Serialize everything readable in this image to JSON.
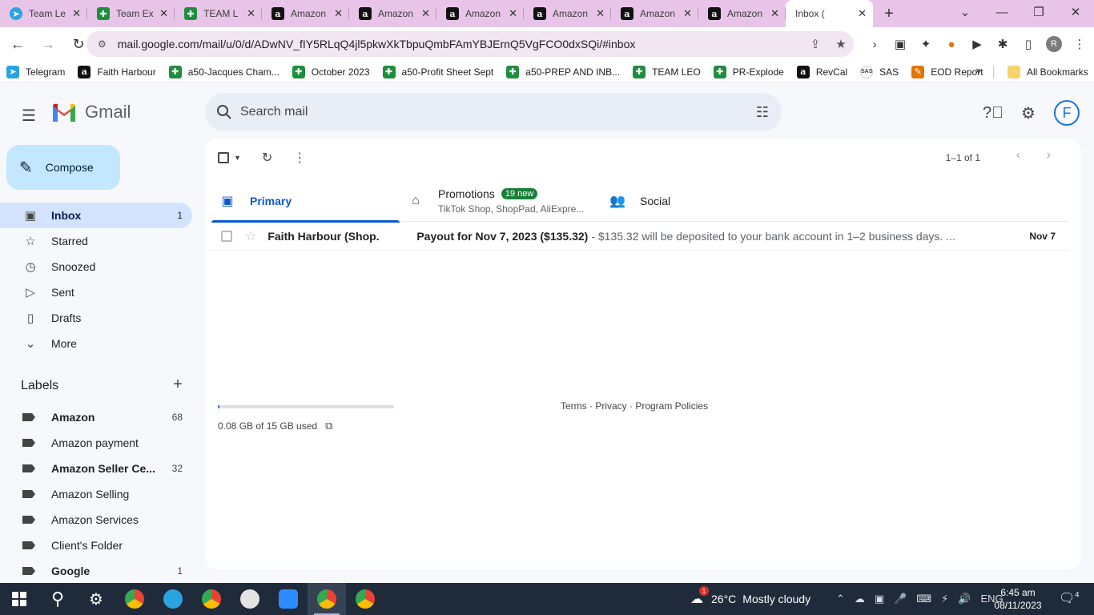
{
  "browser": {
    "tabs": [
      {
        "title": "Team Le",
        "icon": "telegram"
      },
      {
        "title": "Team Ex",
        "icon": "sheets"
      },
      {
        "title": "TEAM L",
        "icon": "sheets"
      },
      {
        "title": "Amazon",
        "icon": "amazon"
      },
      {
        "title": "Amazon",
        "icon": "amazon"
      },
      {
        "title": "Amazon",
        "icon": "amazon"
      },
      {
        "title": "Amazon",
        "icon": "amazon"
      },
      {
        "title": "Amazon",
        "icon": "amazon"
      },
      {
        "title": "Amazon",
        "icon": "amazon"
      },
      {
        "title": "Inbox (",
        "icon": "gmail"
      }
    ],
    "url": "mail.google.com/mail/u/0/d/ADwNV_fIY5RLqQ4jl5pkwXkTbpuQmbFAmYBJErnQ5VgFCO0dxSQi/#inbox",
    "profile_initial": "R",
    "bookmarks": [
      {
        "label": "Telegram",
        "icon": "telegram"
      },
      {
        "label": "Faith Harbour",
        "icon": "amazon"
      },
      {
        "label": "a50-Jacques Cham...",
        "icon": "sheets"
      },
      {
        "label": "October 2023",
        "icon": "sheets"
      },
      {
        "label": "a50-Profit Sheet Sept",
        "icon": "sheets"
      },
      {
        "label": "a50-PREP AND INB...",
        "icon": "sheets"
      },
      {
        "label": "TEAM LEO",
        "icon": "sheets"
      },
      {
        "label": "PR-Explode",
        "icon": "sheets"
      },
      {
        "label": "RevCal",
        "icon": "amazon"
      },
      {
        "label": "SAS",
        "icon": "sas"
      },
      {
        "label": "EOD Report",
        "icon": "eod"
      }
    ],
    "all_bookmarks": "All Bookmarks"
  },
  "gmail": {
    "logo_text": "Gmail",
    "search_placeholder": "Search mail",
    "account_initial": "F",
    "compose": "Compose",
    "nav": [
      {
        "label": "Inbox",
        "count": "1",
        "icon": "inbox-icon"
      },
      {
        "label": "Starred",
        "count": "",
        "icon": "star-icon"
      },
      {
        "label": "Snoozed",
        "count": "",
        "icon": "clock-icon"
      },
      {
        "label": "Sent",
        "count": "",
        "icon": "send-icon"
      },
      {
        "label": "Drafts",
        "count": "",
        "icon": "draft-icon"
      },
      {
        "label": "More",
        "count": "",
        "icon": "chevron-down-icon"
      }
    ],
    "labels_heading": "Labels",
    "labels": [
      {
        "label": "Amazon",
        "count": "68",
        "bold": true
      },
      {
        "label": "Amazon payment",
        "count": "",
        "bold": false
      },
      {
        "label": "Amazon Seller Ce...",
        "count": "32",
        "bold": true
      },
      {
        "label": "Amazon Selling",
        "count": "",
        "bold": false
      },
      {
        "label": "Amazon Services",
        "count": "",
        "bold": false
      },
      {
        "label": "Client's Folder",
        "count": "",
        "bold": false
      },
      {
        "label": "Google",
        "count": "1",
        "bold": true
      }
    ],
    "pager": "1–1 of 1",
    "tabs": {
      "primary": "Primary",
      "promotions": "Promotions",
      "promotions_badge": "19 new",
      "promotions_sub": "TikTok Shop, ShopPad, AliExpre...",
      "social": "Social"
    },
    "emails": [
      {
        "sender": "Faith Harbour (Shop.",
        "subject": "Payout for Nov 7, 2023 ($135.32)",
        "snippet": "- $135.32 will be deposited to your bank account in 1–2 business days. ...",
        "date": "Nov 7"
      }
    ],
    "storage_text": "0.08 GB of 15 GB used",
    "storage_fraction": 0.005,
    "footer": "Terms · Privacy · Program Policies"
  },
  "taskbar": {
    "weather_temp": "26°C",
    "weather_desc": "Mostly cloudy",
    "weather_badge": "1",
    "lang": "ENG",
    "time": "6:45 am",
    "date": "08/11/2023",
    "notif_count": "4"
  },
  "colors": {
    "tab_strip": "#e8c5e8",
    "compose_bg": "#c2e7ff",
    "active_nav": "#d3e3fd",
    "accent": "#0b57d0",
    "badge_green": "#188038"
  }
}
